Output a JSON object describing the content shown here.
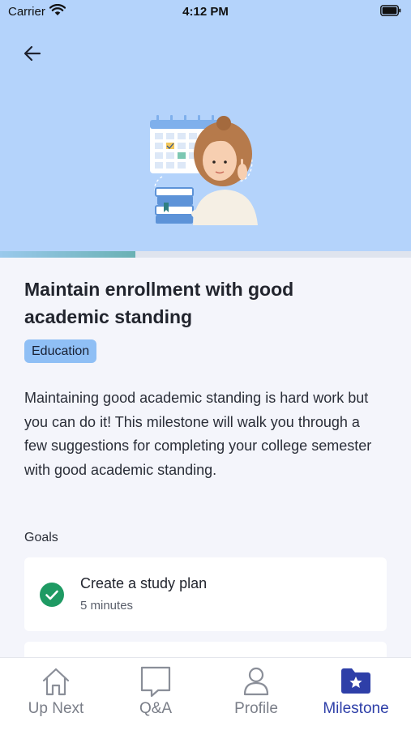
{
  "status_bar": {
    "carrier": "Carrier",
    "time": "4:12 PM"
  },
  "progress": {
    "fraction": 0.33
  },
  "milestone": {
    "title": "Maintain enrollment with good academic standing",
    "category": "Education",
    "description": "Maintaining good academic standing is hard work but you can do it! This milestone will walk you through a few suggestions for completing your college semester with good academic standing."
  },
  "goals": {
    "heading": "Goals",
    "items": [
      {
        "title": "Create a study plan",
        "duration": "5 minutes",
        "completed": true
      }
    ]
  },
  "tabs": [
    {
      "label": "Up Next",
      "icon": "house-icon"
    },
    {
      "label": "Q&A",
      "icon": "chat-bubble-icon"
    },
    {
      "label": "Profile",
      "icon": "person-icon"
    },
    {
      "label": "Milestone",
      "icon": "star-folder-icon",
      "active": true
    }
  ],
  "colors": {
    "hero_bg": "#b4d3fb",
    "accent": "#2e3fa8",
    "badge_bg": "#8fbff5",
    "check": "#1e9a63"
  }
}
